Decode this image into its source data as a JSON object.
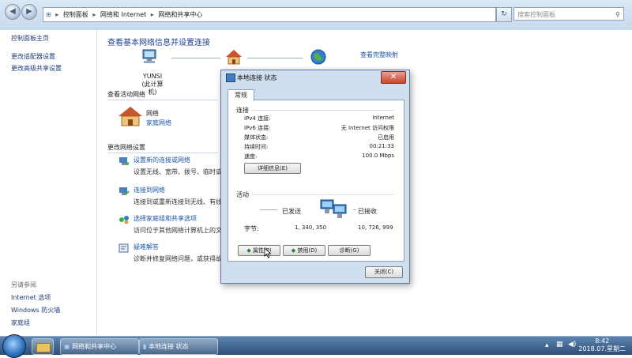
{
  "address_bar": {
    "breadcrumbs": [
      "控制面板",
      "网络和 Internet",
      "网络和共享中心"
    ],
    "search_placeholder": "搜索控制面板"
  },
  "sidebar": {
    "links": [
      "控制面板主页",
      "更改适配器设置",
      "更改高级共享设置"
    ],
    "see_also_heading": "另请参阅",
    "see_also": [
      "Internet 选项",
      "Windows 防火墙",
      "家庭组"
    ]
  },
  "main": {
    "title": "查看基本网络信息并设置连接",
    "see_full_map": "查看完整映射",
    "computer_name": "YUNSI",
    "computer_label": "(此计算机)",
    "active_networks_heading": "查看活动网络",
    "network_name": "网络",
    "network_type": "家庭网络",
    "change_settings_heading": "更改网络设置",
    "tasks": [
      {
        "title": "设置新的连接或网络",
        "desc": "设置无线、宽带、拨号、临时或"
      },
      {
        "title": "连接到网络",
        "desc": "连接到或重新连接到无线、有线、"
      },
      {
        "title": "选择家庭组和共享选项",
        "desc": "访问位于其他网络计算机上的文"
      },
      {
        "title": "疑难解答",
        "desc": "诊断并修复网络问题，或获得故障"
      }
    ]
  },
  "dialog": {
    "title": "本地连接 状态",
    "close_glyph": "✕",
    "tab": "常规",
    "connection_heading": "连接",
    "rows": [
      {
        "key": "IPv4 连接:",
        "value": "Internet"
      },
      {
        "key": "IPv6 连接:",
        "value": "无 Internet 访问权限"
      },
      {
        "key": "媒体状态:",
        "value": "已启用"
      },
      {
        "key": "持续时间:",
        "value": "00:21:33"
      },
      {
        "key": "速度:",
        "value": "100.0 Mbps"
      }
    ],
    "details_button": "详细信息(E)",
    "activity_heading": "活动",
    "sent_label": "已发送",
    "received_label": "已接收",
    "bytes_label": "字节:",
    "bytes_sent": "1, 340, 350",
    "bytes_received": "10, 726, 999",
    "properties_button": "属性(P)",
    "disable_button": "禁用(D)",
    "diagnose_button": "诊断(G)",
    "close_button": "关闭(C)"
  },
  "taskbar": {
    "items": [
      "网络和共享中心",
      "本地连接 状态"
    ],
    "time": "8:42",
    "date": "2018.07.星期二"
  },
  "colors": {
    "link": "#1a55a8",
    "title": "#1e3f8e",
    "taskbar": "#2d4f78"
  }
}
